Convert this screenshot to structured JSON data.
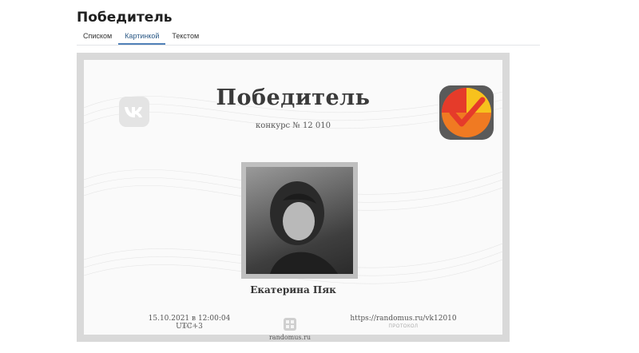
{
  "header": {
    "title": "Победитель"
  },
  "tabs": [
    {
      "label": "Списком",
      "active": false
    },
    {
      "label": "Картинкой",
      "active": true
    },
    {
      "label": "Текстом",
      "active": false
    }
  ],
  "certificate": {
    "title": "Победитель",
    "subtitle": "конкурс № 12 010",
    "winner_name": "Екатерина Пяк",
    "date_value": "15.10.2021 в 12:00:04 UTC+3",
    "date_label": "ДАТА",
    "protocol_value": "https://randomus.ru/vk12010",
    "protocol_label": "ПРОТОКОЛ",
    "site": "randomus.ru",
    "left_logo_icon": "vk-icon",
    "right_logo_icon": "checkmark-badge-icon"
  },
  "colors": {
    "accent": "#5181b8",
    "badge_orange": "#f07a22",
    "badge_red": "#e53b2a",
    "badge_yellow": "#f7c21d",
    "badge_border": "#5a5a5a"
  }
}
